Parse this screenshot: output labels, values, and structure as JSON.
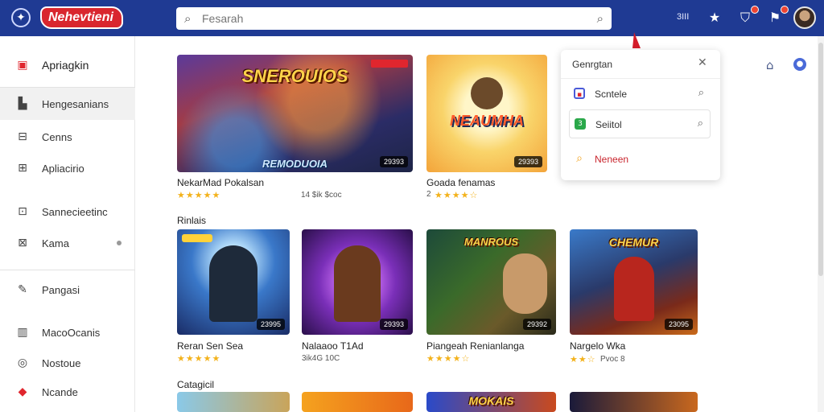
{
  "header": {
    "brand": "Nehevtieni",
    "search_placeholder": "Fesarah",
    "count": "3III"
  },
  "sidebar": {
    "items": [
      {
        "label": "Apriagkin"
      },
      {
        "label": "Hengesanians"
      },
      {
        "label": "Cenns"
      },
      {
        "label": "Apliacirio"
      },
      {
        "label": "Sannecieetinc"
      },
      {
        "label": "Kama"
      },
      {
        "label": "Pangasi"
      },
      {
        "label": "MacoOcanis"
      },
      {
        "label": "Nostoue"
      },
      {
        "label": "Ncande"
      }
    ]
  },
  "featured": [
    {
      "art": "SNEROUIOS",
      "banner": "REMODUOIA",
      "tag": "29393",
      "title": "NekarMad Pokalsan",
      "sub": ""
    },
    {
      "art": "NEAUMHA",
      "banner": "",
      "tag": "29393",
      "title": "Goada fenamas",
      "sub": ""
    },
    {
      "extra_sub": "14 $ik $coc"
    }
  ],
  "featured_sub_rating": "2",
  "section_popular": "Rinlais",
  "popular": [
    {
      "title": "Reran Sen Sea",
      "sub": "",
      "tag": "23995",
      "art": ""
    },
    {
      "title": "Nalaaoo T1Ad",
      "sub": "3ik4G 10C",
      "tag": "29393",
      "art": ""
    },
    {
      "title": "Piangeah Renianlanga",
      "sub": "",
      "tag": "29392",
      "art": "MANROUS"
    },
    {
      "title": "Nargelo Wka",
      "sub": "Pvoc 8",
      "tag": "23095",
      "art": "CHEMUR"
    }
  ],
  "section_categories": "Catagicil",
  "categories": [
    {
      "art": ""
    },
    {
      "art": ""
    },
    {
      "art": "MOKAIS"
    },
    {
      "art": ""
    }
  ],
  "popover": {
    "title": "Genrgtan",
    "items": [
      {
        "label": "Scntele"
      },
      {
        "label": "Seiitol"
      },
      {
        "label": "Neneen"
      }
    ]
  },
  "colors": {
    "topbar": "#1f3a93",
    "brand_red": "#d9262e",
    "star": "#f3b21b"
  }
}
